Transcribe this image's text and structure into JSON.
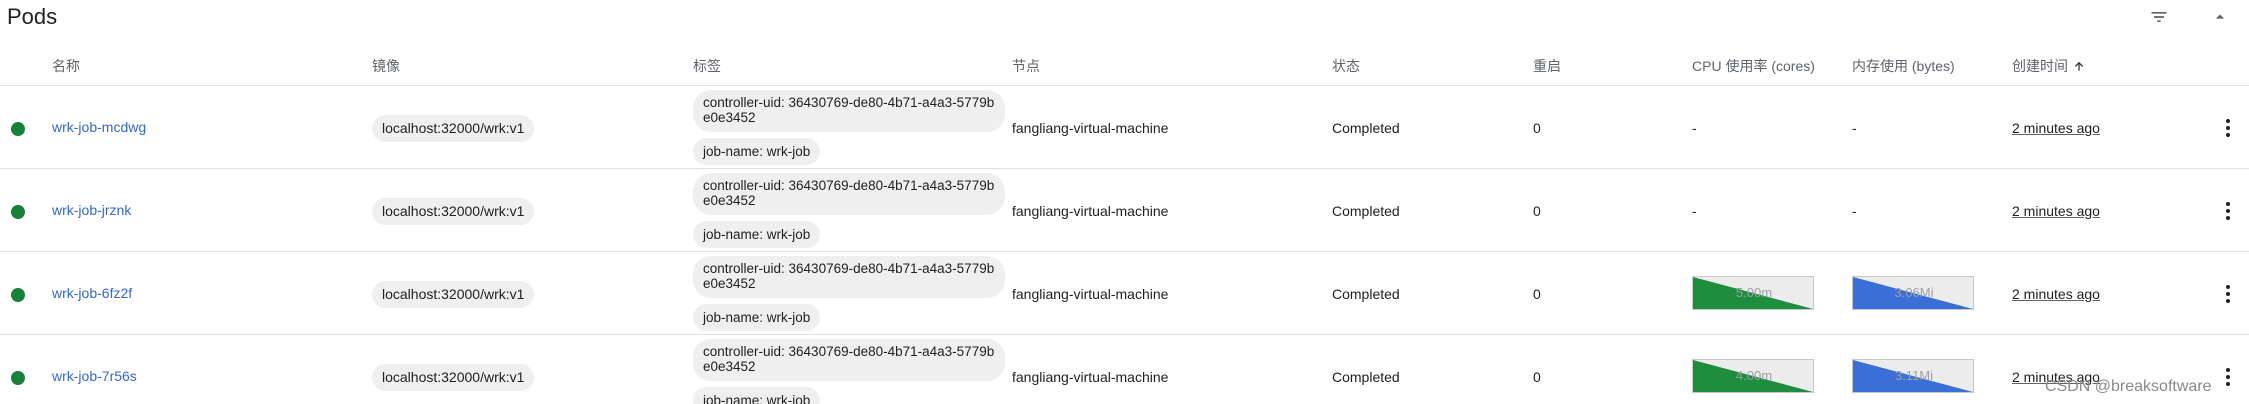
{
  "card": {
    "title": "Pods"
  },
  "header_icons": {
    "filter": "filter-icon",
    "collapse": "chevron-up-icon"
  },
  "columns": {
    "name": "名称",
    "image": "镜像",
    "labels": "标签",
    "node": "节点",
    "status": "状态",
    "restarts": "重启",
    "cpu": "CPU 使用率 (cores)",
    "memory": "内存使用 (bytes)",
    "created": "创建时间"
  },
  "sort": {
    "column": "created",
    "direction": "ascending"
  },
  "colors": {
    "status_ok": "#188038",
    "link": "#3367d6",
    "cpu_fill": "#1e8e3e",
    "mem_fill": "#3b6fd8"
  },
  "rows": [
    {
      "name": "wrk-job-mcdwg",
      "image": "localhost:32000/wrk:v1",
      "label1": "controller-uid: 36430769-de80-4b71-a4a3-5779be0e3452",
      "label2": "job-name: wrk-job",
      "node": "fangliang-virtual-machine",
      "status": "Completed",
      "restarts": "0",
      "cpu": "-",
      "memory": "-",
      "created": "2 minutes ago"
    },
    {
      "name": "wrk-job-jrznk",
      "image": "localhost:32000/wrk:v1",
      "label1": "controller-uid: 36430769-de80-4b71-a4a3-5779be0e3452",
      "label2": "job-name: wrk-job",
      "node": "fangliang-virtual-machine",
      "status": "Completed",
      "restarts": "0",
      "cpu": "-",
      "memory": "-",
      "created": "2 minutes ago"
    },
    {
      "name": "wrk-job-6fz2f",
      "image": "localhost:32000/wrk:v1",
      "label1": "controller-uid: 36430769-de80-4b71-a4a3-5779be0e3452",
      "label2": "job-name: wrk-job",
      "node": "fangliang-virtual-machine",
      "status": "Completed",
      "restarts": "0",
      "cpu": "5.00m",
      "memory": "3.06Mi",
      "created": "2 minutes ago"
    },
    {
      "name": "wrk-job-7r56s",
      "image": "localhost:32000/wrk:v1",
      "label1": "controller-uid: 36430769-de80-4b71-a4a3-5779be0e3452",
      "label2": "job-name: wrk-job",
      "node": "fangliang-virtual-machine",
      "status": "Completed",
      "restarts": "0",
      "cpu": "4.00m",
      "memory": "3.11Mi",
      "created": "2 minutes ago"
    }
  ],
  "watermark": "CSDN @breaksoftware"
}
